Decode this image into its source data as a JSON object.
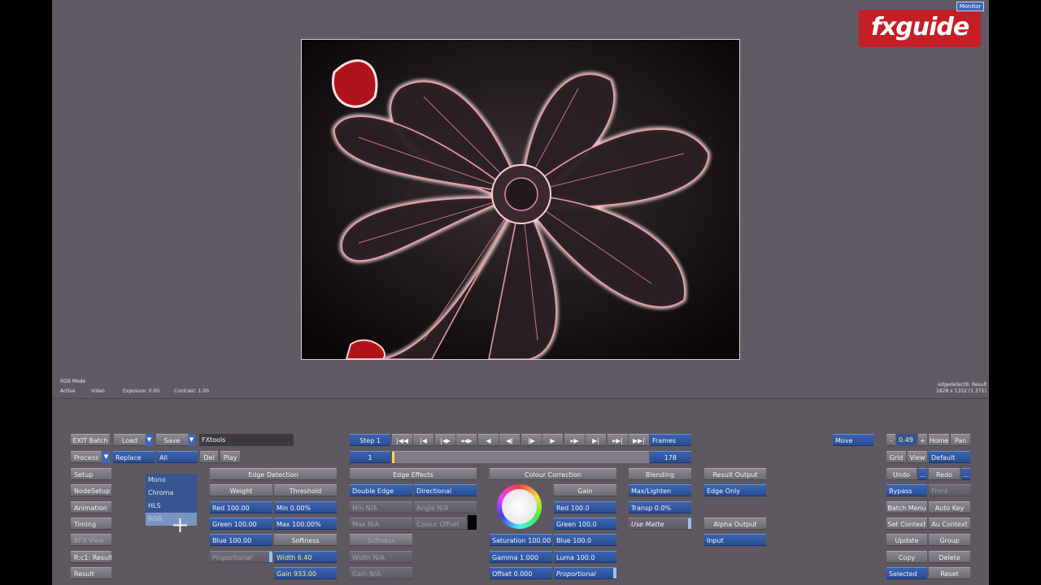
{
  "brand": {
    "logo_text": "fxguide",
    "monitor_label": "Monitor"
  },
  "viewer_info": {
    "mode": "RGB Mode",
    "active": "Active",
    "video": "Video",
    "exposure": "Exposure: 0.00",
    "contrast": "Contrast: 1.00",
    "node_name": "edgedetect8: Result",
    "resolution": "1828 x 1332 (1.372)"
  },
  "batch": {
    "exit": "EXIT Batch",
    "load": "Load",
    "save": "Save",
    "setup_name": "FXtools",
    "process": "Process",
    "replace": "Replace",
    "all": "All",
    "del": "Del",
    "play": "Play",
    "side_buttons": [
      "Setup",
      "NodeSetup",
      "Animation",
      "Timing",
      "BFX View",
      "R:c1: Result :",
      "Result"
    ]
  },
  "mode_menu": {
    "items": [
      "Mono",
      "Chroma",
      "HLS",
      "RGB"
    ],
    "selected": "RGB"
  },
  "transport": {
    "step": "Step 1",
    "frames_label": "Frames",
    "current_frame": "1",
    "total_frames": "178",
    "buttons": [
      "|◀◀",
      "|◀",
      "|◀▸",
      "◂◀▸",
      "◀",
      "◀|",
      "|▶",
      "▶",
      "▸▶",
      "▶|",
      "▸▶|",
      "▶▶|"
    ]
  },
  "edge_detection": {
    "header": "Edge Detection",
    "weight": "Weight",
    "threshold": "Threshold",
    "red": "Red 100.00",
    "green": "Green 100.00",
    "blue": "Blue 100.00",
    "proportional": "Proportional",
    "min": "Min 0.00%",
    "max": "Max 100.00%",
    "softness": "Softness",
    "width": "Width 6.40",
    "gain": "Gain 933.00"
  },
  "edge_effects": {
    "header": "Edge Effects",
    "double_edge": "Double Edge",
    "directional": "Directional",
    "min": "Min N/A",
    "max": "Max N/A",
    "softness": "Softness",
    "width": "Width N/A",
    "gain": "Gain N/A",
    "angle": "Angle N/A",
    "colour_offset": "Colour Offset"
  },
  "colour_correction": {
    "header": "Colour Correction",
    "gain": "Gain",
    "red": "Red 100.0",
    "green": "Green 100.0",
    "blue": "Blue 100.0",
    "luma": "Luma 100.0",
    "proportional": "Proportional",
    "saturation": "Saturation 100.00",
    "gamma": "Gamma 1.000",
    "offset": "Offset 0.000"
  },
  "blending": {
    "header": "Blending",
    "mode": "Max/Lighten",
    "transp": "Transp 0.0%",
    "use_matte": "Use Matte"
  },
  "output": {
    "result_header": "Result Output",
    "result_value": "Edge Only",
    "alpha_header": "Alpha Output",
    "alpha_value": "Input"
  },
  "right_panel": {
    "move": "Move",
    "minus": "-",
    "zoom": "0.49",
    "plus": "+",
    "home": "Home",
    "pan": "Pan",
    "grid": "Grid",
    "view": "View",
    "default": "Default",
    "undo": "Undo",
    "dots": "...",
    "redo": "Redo",
    "bypass": "Bypass",
    "front": "Front",
    "batch_menu": "Batch Menu",
    "auto_key": "Auto Key",
    "set_context": "Set Context",
    "au_context": "Au Context",
    "update": "Update",
    "group": "Group",
    "copy": "Copy",
    "delete": "Delete",
    "selected": "Selected",
    "reset": "Reset"
  },
  "colors": {
    "logo_red": "#c41e26",
    "ui_grey": "#5f5a63",
    "accent_blue": "#2f5aa4"
  }
}
